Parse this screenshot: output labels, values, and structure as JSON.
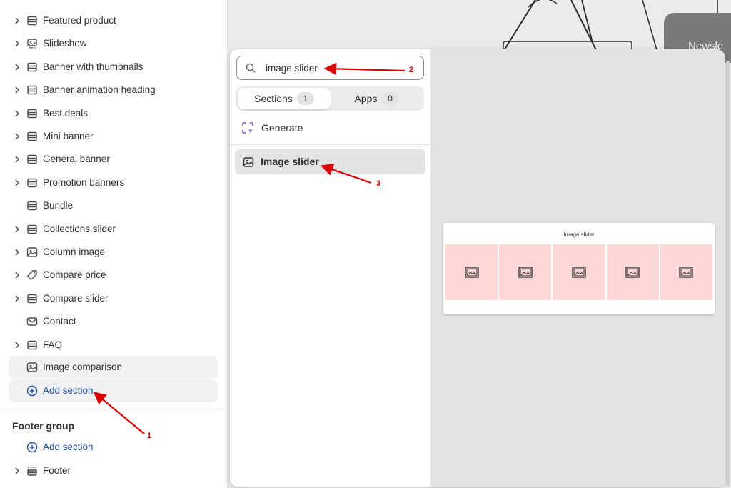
{
  "sidebar": {
    "items": [
      {
        "label": "Featured product",
        "icon": "section-icon",
        "chevron": true
      },
      {
        "label": "Slideshow",
        "icon": "slideshow-icon",
        "chevron": true
      },
      {
        "label": "Banner with thumbnails",
        "icon": "section-icon",
        "chevron": true
      },
      {
        "label": "Banner animation heading",
        "icon": "section-icon",
        "chevron": true
      },
      {
        "label": "Best deals",
        "icon": "section-icon",
        "chevron": true
      },
      {
        "label": "Mini banner",
        "icon": "section-icon",
        "chevron": true
      },
      {
        "label": "General banner",
        "icon": "section-icon",
        "chevron": true
      },
      {
        "label": "Promotion banners",
        "icon": "section-icon",
        "chevron": true
      },
      {
        "label": "Bundle",
        "icon": "section-icon",
        "chevron": false
      },
      {
        "label": "Collections slider",
        "icon": "section-icon",
        "chevron": true
      },
      {
        "label": "Column image",
        "icon": "image-icon",
        "chevron": true
      },
      {
        "label": "Compare price",
        "icon": "price-tag-icon",
        "chevron": true
      },
      {
        "label": "Compare slider",
        "icon": "section-icon",
        "chevron": true
      },
      {
        "label": "Contact",
        "icon": "envelope-icon",
        "chevron": false
      },
      {
        "label": "FAQ",
        "icon": "section-icon",
        "chevron": true
      }
    ],
    "image_comparison_label": "Image comparison",
    "add_section_label": "Add section",
    "footer_group_title": "Footer group",
    "footer_add_section_label": "Add section",
    "footer_label": "Footer"
  },
  "canvas": {
    "newsletter_label": "Newsle"
  },
  "popover": {
    "search_value": "image slider",
    "tabs": [
      {
        "label": "Sections",
        "count": "1"
      },
      {
        "label": "Apps",
        "count": "0"
      }
    ],
    "generate_label": "Generate",
    "result_label": "Image slider",
    "preview_title": "Image slider",
    "preview_slide_count": 5
  },
  "annotations": {
    "labels": [
      "1",
      "2",
      "3"
    ],
    "color": "#d80000"
  },
  "colors": {
    "link_blue": "#1c4e9d",
    "slide_pink": "#fdd7d7",
    "generate_purple": "#7b4bd8"
  }
}
